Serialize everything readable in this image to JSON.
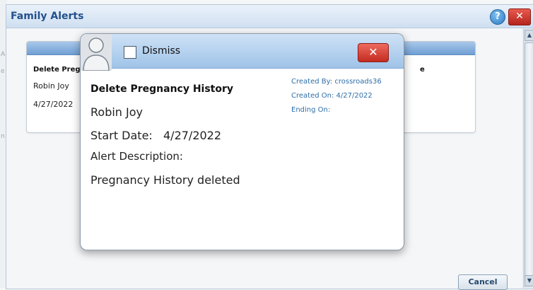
{
  "window": {
    "title": "Family Alerts",
    "help_icon": "help-icon",
    "close_icon": "close-icon"
  },
  "background_card": {
    "alert_name": "Delete Pregr",
    "person": "Robin Joy",
    "date": "4/27/2022",
    "partial_text": "e"
  },
  "buttons": {
    "cancel": "Cancel"
  },
  "popup": {
    "dismiss_label": "Dismiss",
    "alert_title": "Delete Pregnancy History",
    "person": "Robin Joy",
    "start_label": "Start Date:",
    "start_value": "4/27/2022",
    "description_label": "Alert Description:",
    "description": "Pregnancy History deleted",
    "created_by": "Created By: crossroads36",
    "created_on": "Created On: 4/27/2022",
    "ending_on": "Ending On:"
  },
  "colors": {
    "title_blue": "#23518c",
    "meta_blue": "#2f6ea8",
    "close_red": "#c42b20"
  }
}
